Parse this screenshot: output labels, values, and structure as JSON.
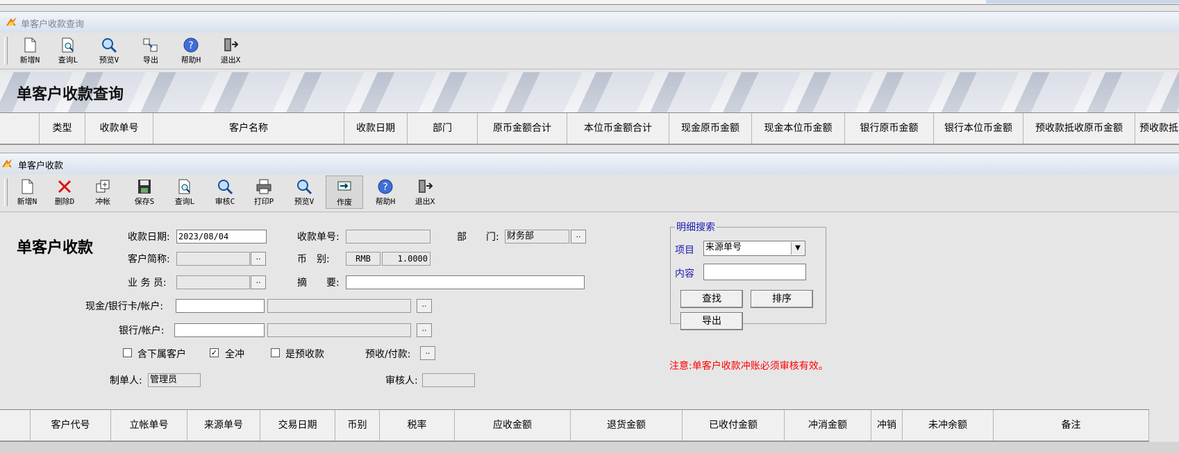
{
  "top_window": {
    "title": "单客户收款查询",
    "toolbar": [
      {
        "label": "新增N",
        "icon": "new-doc-icon"
      },
      {
        "label": "查询L",
        "icon": "query-doc-icon"
      },
      {
        "label": "预览V",
        "icon": "magnifier-icon"
      },
      {
        "label": "导出",
        "icon": "export-icon"
      },
      {
        "label": "帮助H",
        "icon": "help-icon"
      },
      {
        "label": "退出X",
        "icon": "exit-icon"
      }
    ],
    "banner_title": "单客户收款查询",
    "columns": [
      "类型",
      "收款单号",
      "客户名称",
      "收款日期",
      "部门",
      "原币金额合计",
      "本位币金额合计",
      "现金原币金额",
      "现金本位币金额",
      "银行原币金额",
      "银行本位币金额",
      "预收款抵收原币金额",
      "预收款抵"
    ]
  },
  "bottom_window": {
    "title": "单客户收款",
    "toolbar": [
      {
        "label": "新增N",
        "icon": "new-doc-icon"
      },
      {
        "label": "删除D",
        "icon": "delete-icon"
      },
      {
        "label": "冲帐",
        "icon": "offset-icon"
      },
      {
        "label": "保存S",
        "icon": "save-icon"
      },
      {
        "label": "查询L",
        "icon": "query-doc-icon"
      },
      {
        "label": "审核C",
        "icon": "magnifier-icon"
      },
      {
        "label": "打印P",
        "icon": "printer-icon"
      },
      {
        "label": "预览V",
        "icon": "magnifier-icon"
      },
      {
        "label": "作废",
        "icon": "void-icon"
      },
      {
        "label": "帮助H",
        "icon": "help-icon"
      },
      {
        "label": "退出X",
        "icon": "exit-icon"
      }
    ],
    "form_title": "单客户收款",
    "form": {
      "date_label": "收款日期:",
      "date_value": "2023/08/04",
      "bill_no_label": "收款单号:",
      "bill_no_value": "",
      "dept_label": "部　　门:",
      "dept_value": "财务部",
      "customer_label": "客户简称:",
      "currency_label": "币　别:",
      "currency_code": "RMB",
      "exchange_rate": "1.0000",
      "salesman_label": "业 务 员:",
      "summary_label": "摘　　要:",
      "cash_account_label": "现金/银行卡/帐户:",
      "bank_account_label": "银行/帐户:",
      "include_sub_label": "含下属客户",
      "include_sub_checked": false,
      "full_offset_label": "全冲",
      "full_offset_checked": true,
      "prepaid_label": "是预收款",
      "prepaid_checked": false,
      "prepay_label": "预收/付款:",
      "maker_label": "制单人:",
      "maker_value": "管理员",
      "auditor_label": "审核人:",
      "auditor_value": ""
    },
    "detail_search": {
      "legend": "明细搜索",
      "item_label": "项目",
      "item_value": "来源单号",
      "content_label": "内容",
      "content_value": "",
      "find_button": "查找",
      "sort_button": "排序",
      "export_button": "导出"
    },
    "notice": "注意:单客户收款冲账必须审核有效。",
    "notice_color": "#ff0000",
    "columns": [
      "客户代号",
      "立帐单号",
      "来源单号",
      "交易日期",
      "币别",
      "税率",
      "应收金额",
      "退货金额",
      "已收付金额",
      "冲消金额",
      "冲销",
      "未冲余额",
      "备注"
    ]
  },
  "dots": ".."
}
